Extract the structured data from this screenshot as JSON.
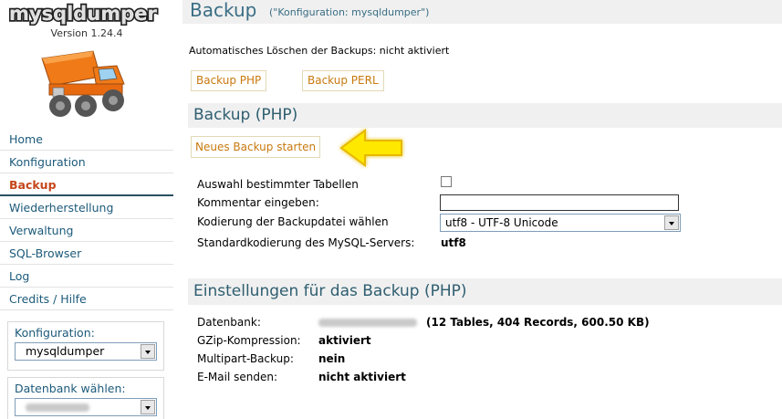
{
  "app": {
    "logo_text": "mysqldumper",
    "version": "Version 1.24.4"
  },
  "sidebar": {
    "items": [
      {
        "label": "Home"
      },
      {
        "label": "Konfiguration"
      },
      {
        "label": "Backup"
      },
      {
        "label": "Wiederherstellung"
      },
      {
        "label": "Verwaltung"
      },
      {
        "label": "SQL-Browser"
      },
      {
        "label": "Log"
      },
      {
        "label": "Credits / Hilfe"
      }
    ],
    "active_item": "Backup",
    "config_label": "Konfiguration:",
    "config_value": "mysqldumper",
    "db_label": "Datenbank wählen:"
  },
  "header": {
    "title": "Backup",
    "subtitle": "(\"Konfiguration: mysqldumper\")"
  },
  "main": {
    "auto_delete": "Automatisches Löschen der Backups: nicht aktiviert",
    "tabs": [
      {
        "label": "Backup PHP"
      },
      {
        "label": "Backup PERL"
      }
    ],
    "section1_title": "Backup (PHP)",
    "start_button": "Neues Backup starten",
    "options": {
      "select_tables_label": "Auswahl bestimmter Tabellen",
      "select_tables_checked": false,
      "comment_label": "Kommentar eingeben:",
      "comment_value": "",
      "encoding_label": "Kodierung der Backupdatei wählen",
      "encoding_value": "utf8 - UTF-8 Unicode",
      "server_encoding_label": "Standardkodierung des MySQL-Servers:",
      "server_encoding_value": "utf8"
    },
    "section2_title": "Einstellungen für das Backup (PHP)",
    "settings": {
      "db_label": "Datenbank:",
      "db_stats": "(12 Tables, 404 Records, 600.50 KB)",
      "gzip_label": "GZip-Kompression:",
      "gzip_value": "aktiviert",
      "multipart_label": "Multipart-Backup:",
      "multipart_value": "nein",
      "email_label": "E-Mail senden:",
      "email_value": "nicht aktiviert"
    }
  },
  "colors": {
    "link": "#1c5a7a",
    "active": "#c4461a",
    "button_text": "#c8790e",
    "title": "#3a6e85",
    "header_bg": "#f0f0f0",
    "arrow": "#ffe800"
  },
  "icons": [
    "truck-logo-icon",
    "arrow-pointer-icon",
    "dropdown-arrow-icon"
  ]
}
